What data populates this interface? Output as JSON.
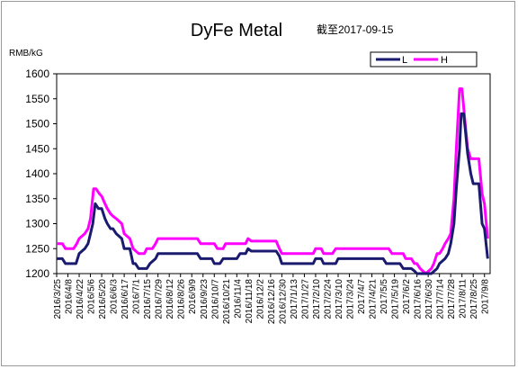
{
  "chart_data": {
    "type": "line",
    "title": "DyFe Metal",
    "subtitle": "截至2017-09-15",
    "ylabel": "RMB/kG",
    "ylim": [
      1200,
      1600
    ],
    "yticks": [
      1200,
      1250,
      1300,
      1350,
      1400,
      1450,
      1500,
      1550,
      1600
    ],
    "grid": false,
    "legend_position": "top-right",
    "x_tick_labels": [
      "2016/3/25",
      "2016/4/8",
      "2016/4/22",
      "2016/5/6",
      "2016/5/20",
      "2016/6/3",
      "2016/6/17",
      "2016/7/1",
      "2016/7/15",
      "2016/7/29",
      "2016/8/12",
      "2016/8/26",
      "2016/9/9",
      "2016/9/23",
      "2016/10/7",
      "2016/10/21",
      "2016/11/4",
      "2016/11/18",
      "2016/12/2",
      "2016/12/16",
      "2016/12/30",
      "2017/1/13",
      "2017/1/27",
      "2017/2/10",
      "2017/2/24",
      "2017/3/10",
      "2017/3/24",
      "2017/4/7",
      "2017/4/21",
      "2017/5/5",
      "2017/5/19",
      "2017/6/2",
      "2017/6/16",
      "2017/6/30",
      "2017/7/14",
      "2017/7/28",
      "2017/8/11",
      "2017/8/25",
      "2017/9/8"
    ],
    "series": [
      {
        "name": "L",
        "color": "#1a1a6e",
        "points": [
          [
            "2016/3/25",
            1230
          ],
          [
            "2016/4/1",
            1230
          ],
          [
            "2016/4/5",
            1220
          ],
          [
            "2016/4/18",
            1220
          ],
          [
            "2016/4/22",
            1240
          ],
          [
            "2016/4/29",
            1250
          ],
          [
            "2016/5/3",
            1260
          ],
          [
            "2016/5/6",
            1280
          ],
          [
            "2016/5/9",
            1300
          ],
          [
            "2016/5/12",
            1340
          ],
          [
            "2016/5/16",
            1330
          ],
          [
            "2016/5/20",
            1330
          ],
          [
            "2016/5/24",
            1310
          ],
          [
            "2016/5/27",
            1300
          ],
          [
            "2016/5/31",
            1290
          ],
          [
            "2016/6/3",
            1290
          ],
          [
            "2016/6/7",
            1280
          ],
          [
            "2016/6/14",
            1270
          ],
          [
            "2016/6/17",
            1250
          ],
          [
            "2016/6/24",
            1250
          ],
          [
            "2016/6/28",
            1220
          ],
          [
            "2016/7/1",
            1220
          ],
          [
            "2016/7/5",
            1210
          ],
          [
            "2016/7/15",
            1210
          ],
          [
            "2016/7/19",
            1220
          ],
          [
            "2016/7/26",
            1230
          ],
          [
            "2016/7/29",
            1240
          ],
          [
            "2016/9/16",
            1240
          ],
          [
            "2016/9/20",
            1230
          ],
          [
            "2016/10/4",
            1230
          ],
          [
            "2016/10/7",
            1220
          ],
          [
            "2016/10/14",
            1220
          ],
          [
            "2016/10/18",
            1230
          ],
          [
            "2016/11/4",
            1230
          ],
          [
            "2016/11/8",
            1240
          ],
          [
            "2016/11/15",
            1240
          ],
          [
            "2016/11/18",
            1250
          ],
          [
            "2016/11/22",
            1245
          ],
          [
            "2016/12/23",
            1245
          ],
          [
            "2016/12/27",
            1235
          ],
          [
            "2016/12/30",
            1220
          ],
          [
            "2017/2/7",
            1220
          ],
          [
            "2017/2/10",
            1230
          ],
          [
            "2017/2/17",
            1230
          ],
          [
            "2017/2/20",
            1220
          ],
          [
            "2017/3/7",
            1220
          ],
          [
            "2017/3/10",
            1230
          ],
          [
            "2017/5/5",
            1230
          ],
          [
            "2017/5/9",
            1220
          ],
          [
            "2017/5/26",
            1220
          ],
          [
            "2017/5/30",
            1210
          ],
          [
            "2017/6/9",
            1210
          ],
          [
            "2017/6/13",
            1205
          ],
          [
            "2017/6/16",
            1200
          ],
          [
            "2017/6/27",
            1200
          ],
          [
            "2017/7/4",
            1200
          ],
          [
            "2017/7/11",
            1210
          ],
          [
            "2017/7/14",
            1220
          ],
          [
            "2017/7/21",
            1230
          ],
          [
            "2017/7/25",
            1240
          ],
          [
            "2017/7/28",
            1260
          ],
          [
            "2017/8/1",
            1300
          ],
          [
            "2017/8/4",
            1370
          ],
          [
            "2017/8/8",
            1450
          ],
          [
            "2017/8/10",
            1520
          ],
          [
            "2017/8/13",
            1520
          ],
          [
            "2017/8/15",
            1490
          ],
          [
            "2017/8/18",
            1440
          ],
          [
            "2017/8/22",
            1400
          ],
          [
            "2017/8/25",
            1380
          ],
          [
            "2017/9/1",
            1380
          ],
          [
            "2017/9/5",
            1300
          ],
          [
            "2017/9/8",
            1290
          ],
          [
            "2017/9/12",
            1230
          ]
        ]
      },
      {
        "name": "H",
        "color": "#ff00ff",
        "points": [
          [
            "2016/3/25",
            1260
          ],
          [
            "2016/4/1",
            1260
          ],
          [
            "2016/4/5",
            1250
          ],
          [
            "2016/4/15",
            1250
          ],
          [
            "2016/4/19",
            1260
          ],
          [
            "2016/4/22",
            1270
          ],
          [
            "2016/4/29",
            1280
          ],
          [
            "2016/5/3",
            1290
          ],
          [
            "2016/5/6",
            1310
          ],
          [
            "2016/5/10",
            1370
          ],
          [
            "2016/5/13",
            1370
          ],
          [
            "2016/5/17",
            1360
          ],
          [
            "2016/5/20",
            1355
          ],
          [
            "2016/5/24",
            1340
          ],
          [
            "2016/5/27",
            1330
          ],
          [
            "2016/5/31",
            1320
          ],
          [
            "2016/6/3",
            1315
          ],
          [
            "2016/6/7",
            1310
          ],
          [
            "2016/6/14",
            1300
          ],
          [
            "2016/6/17",
            1280
          ],
          [
            "2016/6/24",
            1270
          ],
          [
            "2016/6/28",
            1250
          ],
          [
            "2016/7/5",
            1240
          ],
          [
            "2016/7/12",
            1240
          ],
          [
            "2016/7/15",
            1250
          ],
          [
            "2016/7/22",
            1250
          ],
          [
            "2016/7/26",
            1260
          ],
          [
            "2016/7/29",
            1270
          ],
          [
            "2016/9/16",
            1270
          ],
          [
            "2016/9/20",
            1260
          ],
          [
            "2016/10/7",
            1260
          ],
          [
            "2016/10/11",
            1250
          ],
          [
            "2016/10/18",
            1250
          ],
          [
            "2016/10/21",
            1260
          ],
          [
            "2016/11/15",
            1260
          ],
          [
            "2016/11/18",
            1270
          ],
          [
            "2016/11/22",
            1265
          ],
          [
            "2016/12/23",
            1265
          ],
          [
            "2016/12/27",
            1250
          ],
          [
            "2016/12/30",
            1240
          ],
          [
            "2017/2/7",
            1240
          ],
          [
            "2017/2/10",
            1250
          ],
          [
            "2017/2/17",
            1250
          ],
          [
            "2017/2/20",
            1240
          ],
          [
            "2017/3/3",
            1240
          ],
          [
            "2017/3/7",
            1250
          ],
          [
            "2017/5/12",
            1250
          ],
          [
            "2017/5/16",
            1240
          ],
          [
            "2017/5/30",
            1240
          ],
          [
            "2017/6/2",
            1230
          ],
          [
            "2017/6/9",
            1230
          ],
          [
            "2017/6/13",
            1220
          ],
          [
            "2017/6/16",
            1220
          ],
          [
            "2017/6/20",
            1210
          ],
          [
            "2017/6/27",
            1200
          ],
          [
            "2017/7/4",
            1210
          ],
          [
            "2017/7/7",
            1220
          ],
          [
            "2017/7/11",
            1240
          ],
          [
            "2017/7/14",
            1240
          ],
          [
            "2017/7/18",
            1250
          ],
          [
            "2017/7/21",
            1260
          ],
          [
            "2017/7/25",
            1270
          ],
          [
            "2017/7/28",
            1280
          ],
          [
            "2017/8/1",
            1350
          ],
          [
            "2017/8/4",
            1450
          ],
          [
            "2017/8/8",
            1570
          ],
          [
            "2017/8/11",
            1570
          ],
          [
            "2017/8/15",
            1500
          ],
          [
            "2017/8/18",
            1450
          ],
          [
            "2017/8/22",
            1430
          ],
          [
            "2017/9/1",
            1430
          ],
          [
            "2017/9/5",
            1360
          ],
          [
            "2017/9/8",
            1340
          ],
          [
            "2017/9/12",
            1270
          ]
        ]
      }
    ]
  }
}
